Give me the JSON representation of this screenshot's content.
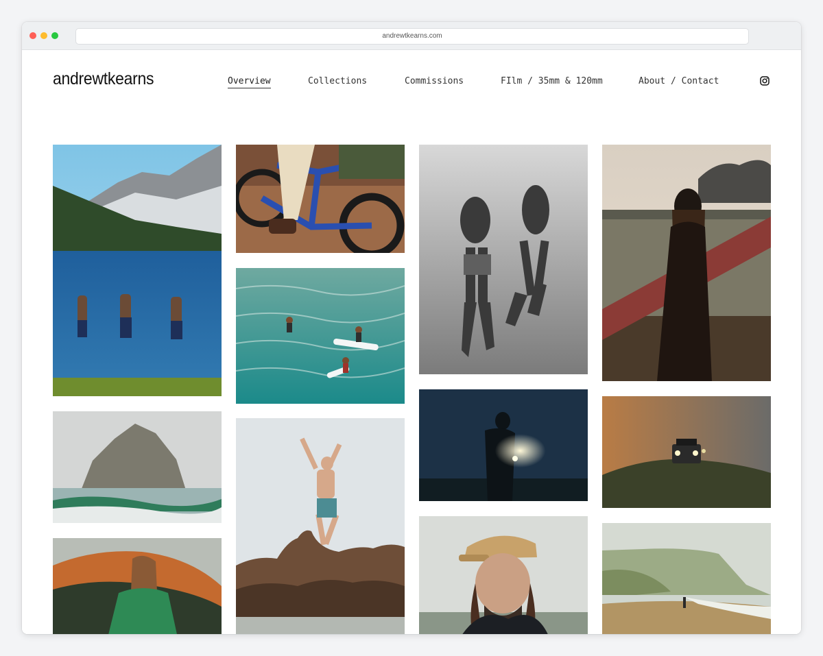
{
  "browser": {
    "url": "andrewtkearns.com"
  },
  "site": {
    "logo": "andrewtkearns",
    "nav": [
      {
        "label": "Overview",
        "active": true
      },
      {
        "label": "Collections",
        "active": false
      },
      {
        "label": "Commissions",
        "active": false
      },
      {
        "label": "FIlm / 35mm & 120mm",
        "active": false
      },
      {
        "label": "About / Contact",
        "active": false
      }
    ],
    "social_icon": "instagram-icon"
  },
  "gallery": {
    "photos": [
      {
        "subject": "mountain-lake-swimmers"
      },
      {
        "subject": "sea-stack-surf"
      },
      {
        "subject": "woman-green-jacket"
      },
      {
        "subject": "electric-bike"
      },
      {
        "subject": "surfers-turquoise-water"
      },
      {
        "subject": "man-jumping-rocks"
      },
      {
        "subject": "underwater-bw-divers"
      },
      {
        "subject": "silhouette-headlamp-night"
      },
      {
        "subject": "man-cap-portrait"
      },
      {
        "subject": "woman-surfboard-sunset"
      },
      {
        "subject": "truck-headlights-fog"
      },
      {
        "subject": "beach-cliff-mist"
      }
    ]
  }
}
